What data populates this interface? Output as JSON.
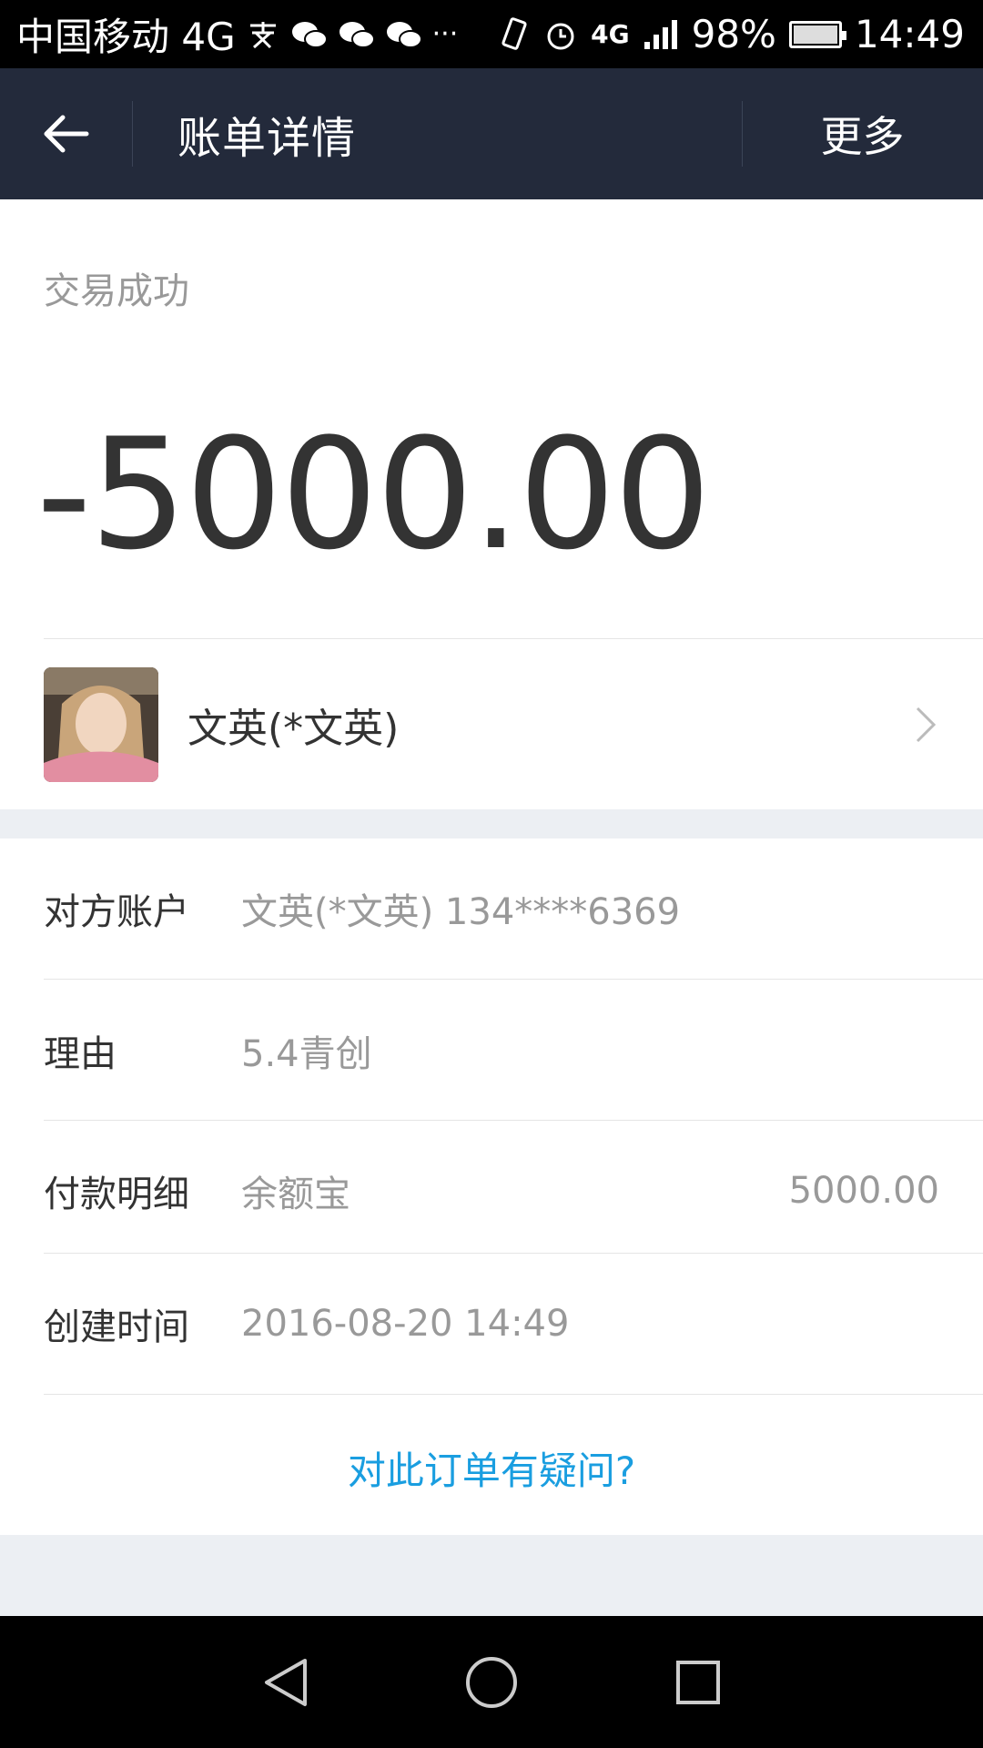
{
  "status_bar": {
    "carrier": "中国移动 4G",
    "network": "4G",
    "battery": "98%",
    "time": "14:49"
  },
  "header": {
    "title": "账单详情",
    "more_label": "更多"
  },
  "transaction": {
    "status": "交易成功",
    "amount": "-5000.00",
    "payee_name": "文英(*文英)"
  },
  "details": {
    "account_label": "对方账户",
    "account_value": "文英(*文英) 134****6369",
    "reason_label": "理由",
    "reason_value": "5.4青创",
    "payment_label": "付款明细",
    "payment_method": "余额宝",
    "payment_amount": "5000.00",
    "time_label": "创建时间",
    "time_value": "2016-08-20 14:49"
  },
  "question_link": "对此订单有疑问?",
  "colors": {
    "header_bg": "#232a3b",
    "link": "#1a9ee0",
    "amount": "#333333",
    "muted": "#999999"
  }
}
